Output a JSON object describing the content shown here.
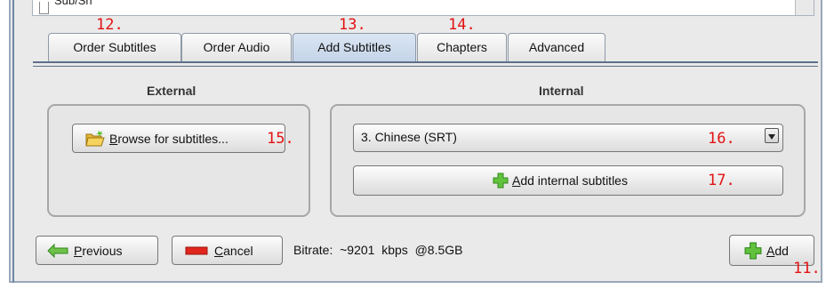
{
  "top_list": {
    "visible_item": "Sub/Sh"
  },
  "tabs": [
    {
      "label": "Order Subtitles",
      "active": false
    },
    {
      "label": "Order Audio",
      "active": false
    },
    {
      "label": "Add Subtitles",
      "active": true
    },
    {
      "label": "Chapters",
      "active": false
    },
    {
      "label": "Advanced",
      "active": false
    }
  ],
  "external": {
    "heading": "External",
    "browse_button": {
      "mnemonic": "B",
      "rest": "rowse for subtitles..."
    }
  },
  "internal": {
    "heading": "Internal",
    "selected_track": "3. Chinese (SRT)",
    "add_button": {
      "prefix": "A",
      "rest": "dd internal subtitles"
    }
  },
  "footer": {
    "previous": {
      "mnemonic": "P",
      "rest": "revious"
    },
    "cancel": {
      "mnemonic": "C",
      "rest": "ancel"
    },
    "bitrate_text": "Bitrate:  ~9201  kbps  @8.5GB",
    "add": {
      "mnemonic": "A",
      "rest": "dd"
    }
  },
  "annotations": {
    "n11": "11.",
    "n12": "12.",
    "n13": "13.",
    "n14": "14.",
    "n15": "15.",
    "n16": "16.",
    "n17": "17."
  },
  "colors": {
    "annotation": "#e21212",
    "plus_icon": "#63c23d",
    "cancel_icon": "#e0261d",
    "arrow_icon": "#6fc14a",
    "folder_icon": "#e7b735"
  }
}
